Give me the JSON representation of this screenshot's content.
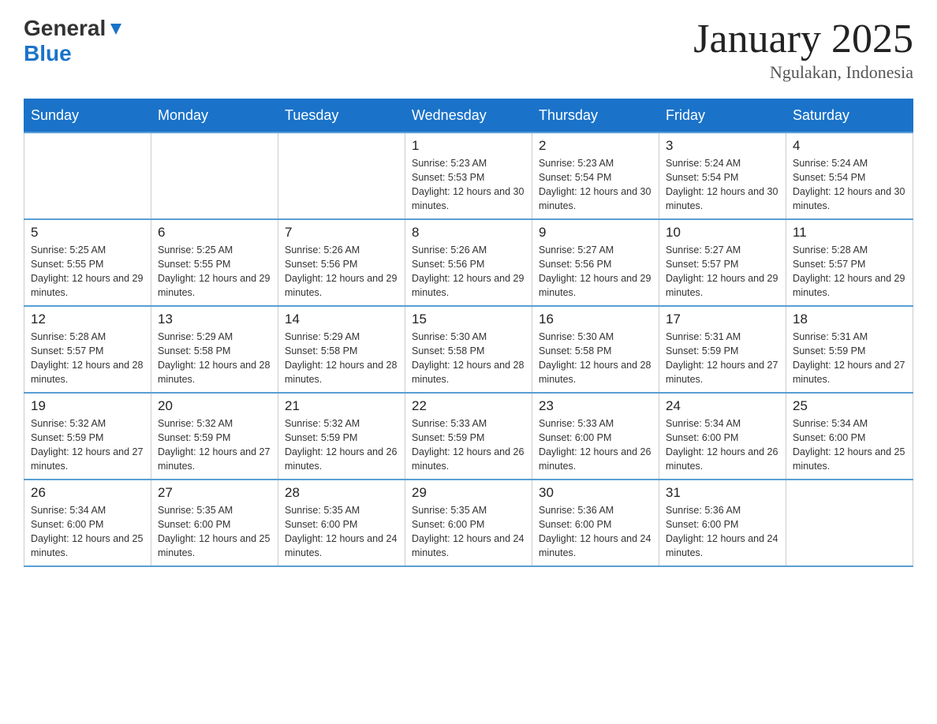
{
  "header": {
    "logo": {
      "general": "General",
      "blue": "Blue",
      "triangle": "▲"
    },
    "title": "January 2025",
    "subtitle": "Ngulakan, Indonesia"
  },
  "calendar": {
    "days_of_week": [
      "Sunday",
      "Monday",
      "Tuesday",
      "Wednesday",
      "Thursday",
      "Friday",
      "Saturday"
    ],
    "weeks": [
      [
        {
          "day": "",
          "info": ""
        },
        {
          "day": "",
          "info": ""
        },
        {
          "day": "",
          "info": ""
        },
        {
          "day": "1",
          "info": "Sunrise: 5:23 AM\nSunset: 5:53 PM\nDaylight: 12 hours and 30 minutes."
        },
        {
          "day": "2",
          "info": "Sunrise: 5:23 AM\nSunset: 5:54 PM\nDaylight: 12 hours and 30 minutes."
        },
        {
          "day": "3",
          "info": "Sunrise: 5:24 AM\nSunset: 5:54 PM\nDaylight: 12 hours and 30 minutes."
        },
        {
          "day": "4",
          "info": "Sunrise: 5:24 AM\nSunset: 5:54 PM\nDaylight: 12 hours and 30 minutes."
        }
      ],
      [
        {
          "day": "5",
          "info": "Sunrise: 5:25 AM\nSunset: 5:55 PM\nDaylight: 12 hours and 29 minutes."
        },
        {
          "day": "6",
          "info": "Sunrise: 5:25 AM\nSunset: 5:55 PM\nDaylight: 12 hours and 29 minutes."
        },
        {
          "day": "7",
          "info": "Sunrise: 5:26 AM\nSunset: 5:56 PM\nDaylight: 12 hours and 29 minutes."
        },
        {
          "day": "8",
          "info": "Sunrise: 5:26 AM\nSunset: 5:56 PM\nDaylight: 12 hours and 29 minutes."
        },
        {
          "day": "9",
          "info": "Sunrise: 5:27 AM\nSunset: 5:56 PM\nDaylight: 12 hours and 29 minutes."
        },
        {
          "day": "10",
          "info": "Sunrise: 5:27 AM\nSunset: 5:57 PM\nDaylight: 12 hours and 29 minutes."
        },
        {
          "day": "11",
          "info": "Sunrise: 5:28 AM\nSunset: 5:57 PM\nDaylight: 12 hours and 29 minutes."
        }
      ],
      [
        {
          "day": "12",
          "info": "Sunrise: 5:28 AM\nSunset: 5:57 PM\nDaylight: 12 hours and 28 minutes."
        },
        {
          "day": "13",
          "info": "Sunrise: 5:29 AM\nSunset: 5:58 PM\nDaylight: 12 hours and 28 minutes."
        },
        {
          "day": "14",
          "info": "Sunrise: 5:29 AM\nSunset: 5:58 PM\nDaylight: 12 hours and 28 minutes."
        },
        {
          "day": "15",
          "info": "Sunrise: 5:30 AM\nSunset: 5:58 PM\nDaylight: 12 hours and 28 minutes."
        },
        {
          "day": "16",
          "info": "Sunrise: 5:30 AM\nSunset: 5:58 PM\nDaylight: 12 hours and 28 minutes."
        },
        {
          "day": "17",
          "info": "Sunrise: 5:31 AM\nSunset: 5:59 PM\nDaylight: 12 hours and 27 minutes."
        },
        {
          "day": "18",
          "info": "Sunrise: 5:31 AM\nSunset: 5:59 PM\nDaylight: 12 hours and 27 minutes."
        }
      ],
      [
        {
          "day": "19",
          "info": "Sunrise: 5:32 AM\nSunset: 5:59 PM\nDaylight: 12 hours and 27 minutes."
        },
        {
          "day": "20",
          "info": "Sunrise: 5:32 AM\nSunset: 5:59 PM\nDaylight: 12 hours and 27 minutes."
        },
        {
          "day": "21",
          "info": "Sunrise: 5:32 AM\nSunset: 5:59 PM\nDaylight: 12 hours and 26 minutes."
        },
        {
          "day": "22",
          "info": "Sunrise: 5:33 AM\nSunset: 5:59 PM\nDaylight: 12 hours and 26 minutes."
        },
        {
          "day": "23",
          "info": "Sunrise: 5:33 AM\nSunset: 6:00 PM\nDaylight: 12 hours and 26 minutes."
        },
        {
          "day": "24",
          "info": "Sunrise: 5:34 AM\nSunset: 6:00 PM\nDaylight: 12 hours and 26 minutes."
        },
        {
          "day": "25",
          "info": "Sunrise: 5:34 AM\nSunset: 6:00 PM\nDaylight: 12 hours and 25 minutes."
        }
      ],
      [
        {
          "day": "26",
          "info": "Sunrise: 5:34 AM\nSunset: 6:00 PM\nDaylight: 12 hours and 25 minutes."
        },
        {
          "day": "27",
          "info": "Sunrise: 5:35 AM\nSunset: 6:00 PM\nDaylight: 12 hours and 25 minutes."
        },
        {
          "day": "28",
          "info": "Sunrise: 5:35 AM\nSunset: 6:00 PM\nDaylight: 12 hours and 24 minutes."
        },
        {
          "day": "29",
          "info": "Sunrise: 5:35 AM\nSunset: 6:00 PM\nDaylight: 12 hours and 24 minutes."
        },
        {
          "day": "30",
          "info": "Sunrise: 5:36 AM\nSunset: 6:00 PM\nDaylight: 12 hours and 24 minutes."
        },
        {
          "day": "31",
          "info": "Sunrise: 5:36 AM\nSunset: 6:00 PM\nDaylight: 12 hours and 24 minutes."
        },
        {
          "day": "",
          "info": ""
        }
      ]
    ]
  }
}
